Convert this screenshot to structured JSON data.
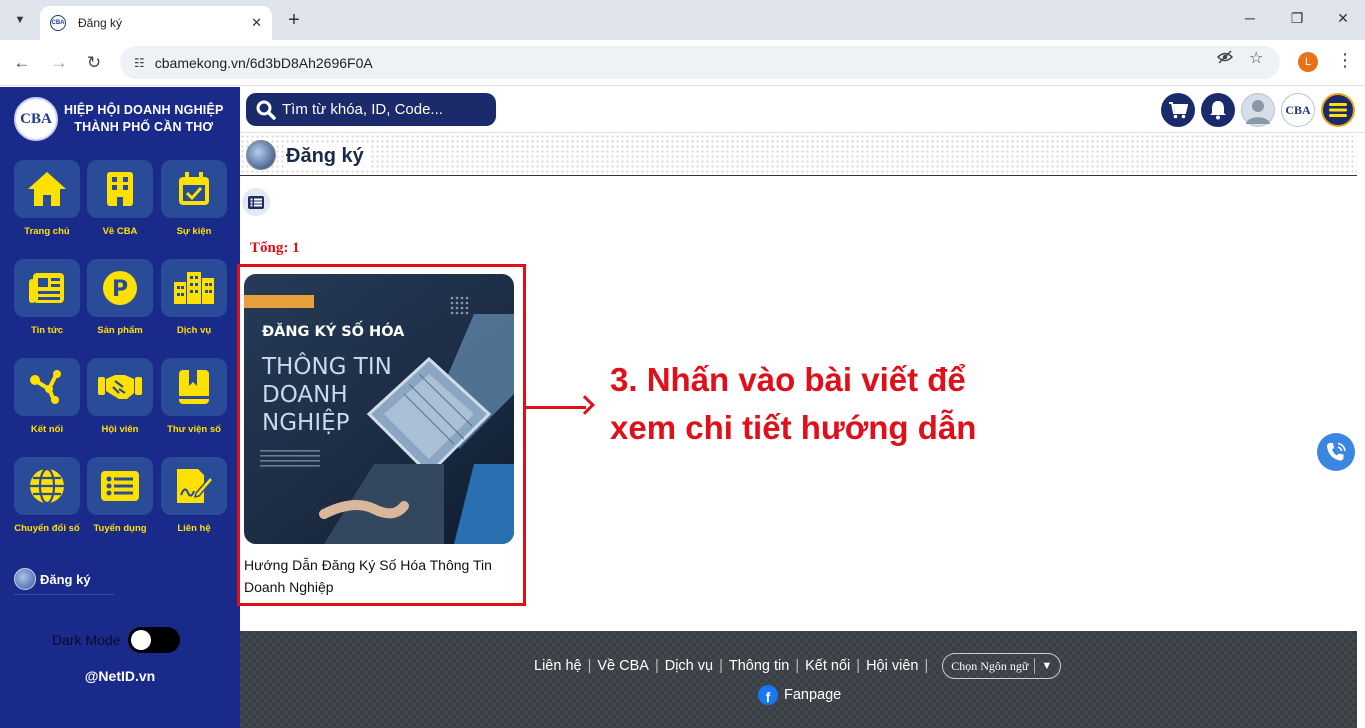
{
  "browser": {
    "tab_title": "Đăng ký",
    "tab_favicon": "CBA",
    "url": "cbamekong.vn/6d3bD8Ah2696F0A",
    "profile_initial": "L"
  },
  "sidebar": {
    "brand_line1": "HIỆP HỘI DOANH NGHIỆP",
    "brand_line2": "THÀNH PHỐ CẦN THƠ",
    "logo_text": "CBA",
    "items": [
      {
        "label": "Trang chủ",
        "icon": "home-icon"
      },
      {
        "label": "Về CBA",
        "icon": "building-icon"
      },
      {
        "label": "Sự kiện",
        "icon": "calendar-check-icon"
      },
      {
        "label": "Tin tức",
        "icon": "newspaper-icon"
      },
      {
        "label": "Sản phẩm",
        "icon": "product-p-icon"
      },
      {
        "label": "Dịch vụ",
        "icon": "city-icon"
      },
      {
        "label": "Kết nối",
        "icon": "network-icon"
      },
      {
        "label": "Hội viên",
        "icon": "handshake-icon"
      },
      {
        "label": "Thư viện số",
        "icon": "book-bookmark-icon"
      },
      {
        "label": "Chuyển đổi số",
        "icon": "globe-icon"
      },
      {
        "label": "Tuyển dụng",
        "icon": "list-icon"
      },
      {
        "label": "Liên hệ",
        "icon": "signature-icon"
      }
    ],
    "current_page": "Đăng ký",
    "dark_mode_label": "Dark Mode",
    "footer_brand": "@NetID.vn"
  },
  "header": {
    "search_placeholder": "Tìm từ khóa, ID, Code...",
    "user_logo_text": "CBA"
  },
  "page": {
    "title": "Đăng ký",
    "total": "Tổng: 1",
    "card": {
      "title": "Hướng Dẫn Đăng Ký Số Hóa Thông Tin Doanh Nghiệp",
      "image_line1": "ĐĂNG KÝ SỐ HÓA",
      "image_line2": "THÔNG TIN",
      "image_line3": "DOANH",
      "image_line4": "NGHIỆP"
    },
    "callout_line1": "3. Nhấn vào bài viết để",
    "callout_line2": "xem chi tiết hướng dẫn"
  },
  "footer": {
    "links": [
      "Liên hệ",
      "Về CBA",
      "Dịch vụ",
      "Thông tin",
      "Kết nối",
      "Hội viên"
    ],
    "language_label": "Chọn Ngôn ngữ",
    "fanpage": "Fanpage"
  },
  "colors": {
    "sidebar_bg": "#1a2a8a",
    "tile_bg": "#2a4b98",
    "icon_yellow": "#ffe100",
    "accent_red": "#e0101a",
    "footer_bg": "#3a3f45"
  }
}
